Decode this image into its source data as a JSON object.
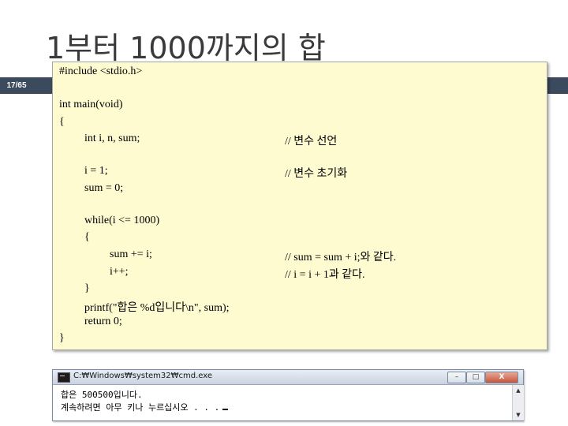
{
  "slide": {
    "title": "1부터 1000까지의 합",
    "page_number": "17/65"
  },
  "code": {
    "lines": [
      "#include <stdio.h>",
      "int main(void)",
      "{",
      "int i, n, sum;",
      "i = 1;",
      "sum = 0;",
      "while(i <= 1000)",
      "{",
      "sum += i;",
      "i++;",
      "}",
      "printf(\"합은 %d입니다\\n\", sum);",
      "return 0;",
      "}"
    ],
    "comments": [
      "// 변수 선언",
      "// 변수 초기화",
      "// sum = sum + i;와 같다.",
      "// i = i + 1과 같다."
    ]
  },
  "console": {
    "title": "C:₩Windows₩system32₩cmd.exe",
    "min_label": "–",
    "max_label": "□",
    "close_label": "X",
    "lines": [
      "합은 500500입니다.",
      "계속하려면 아무 키나 누르십시오 . . ."
    ],
    "scroll_up": "▲",
    "scroll_down": "▼"
  }
}
